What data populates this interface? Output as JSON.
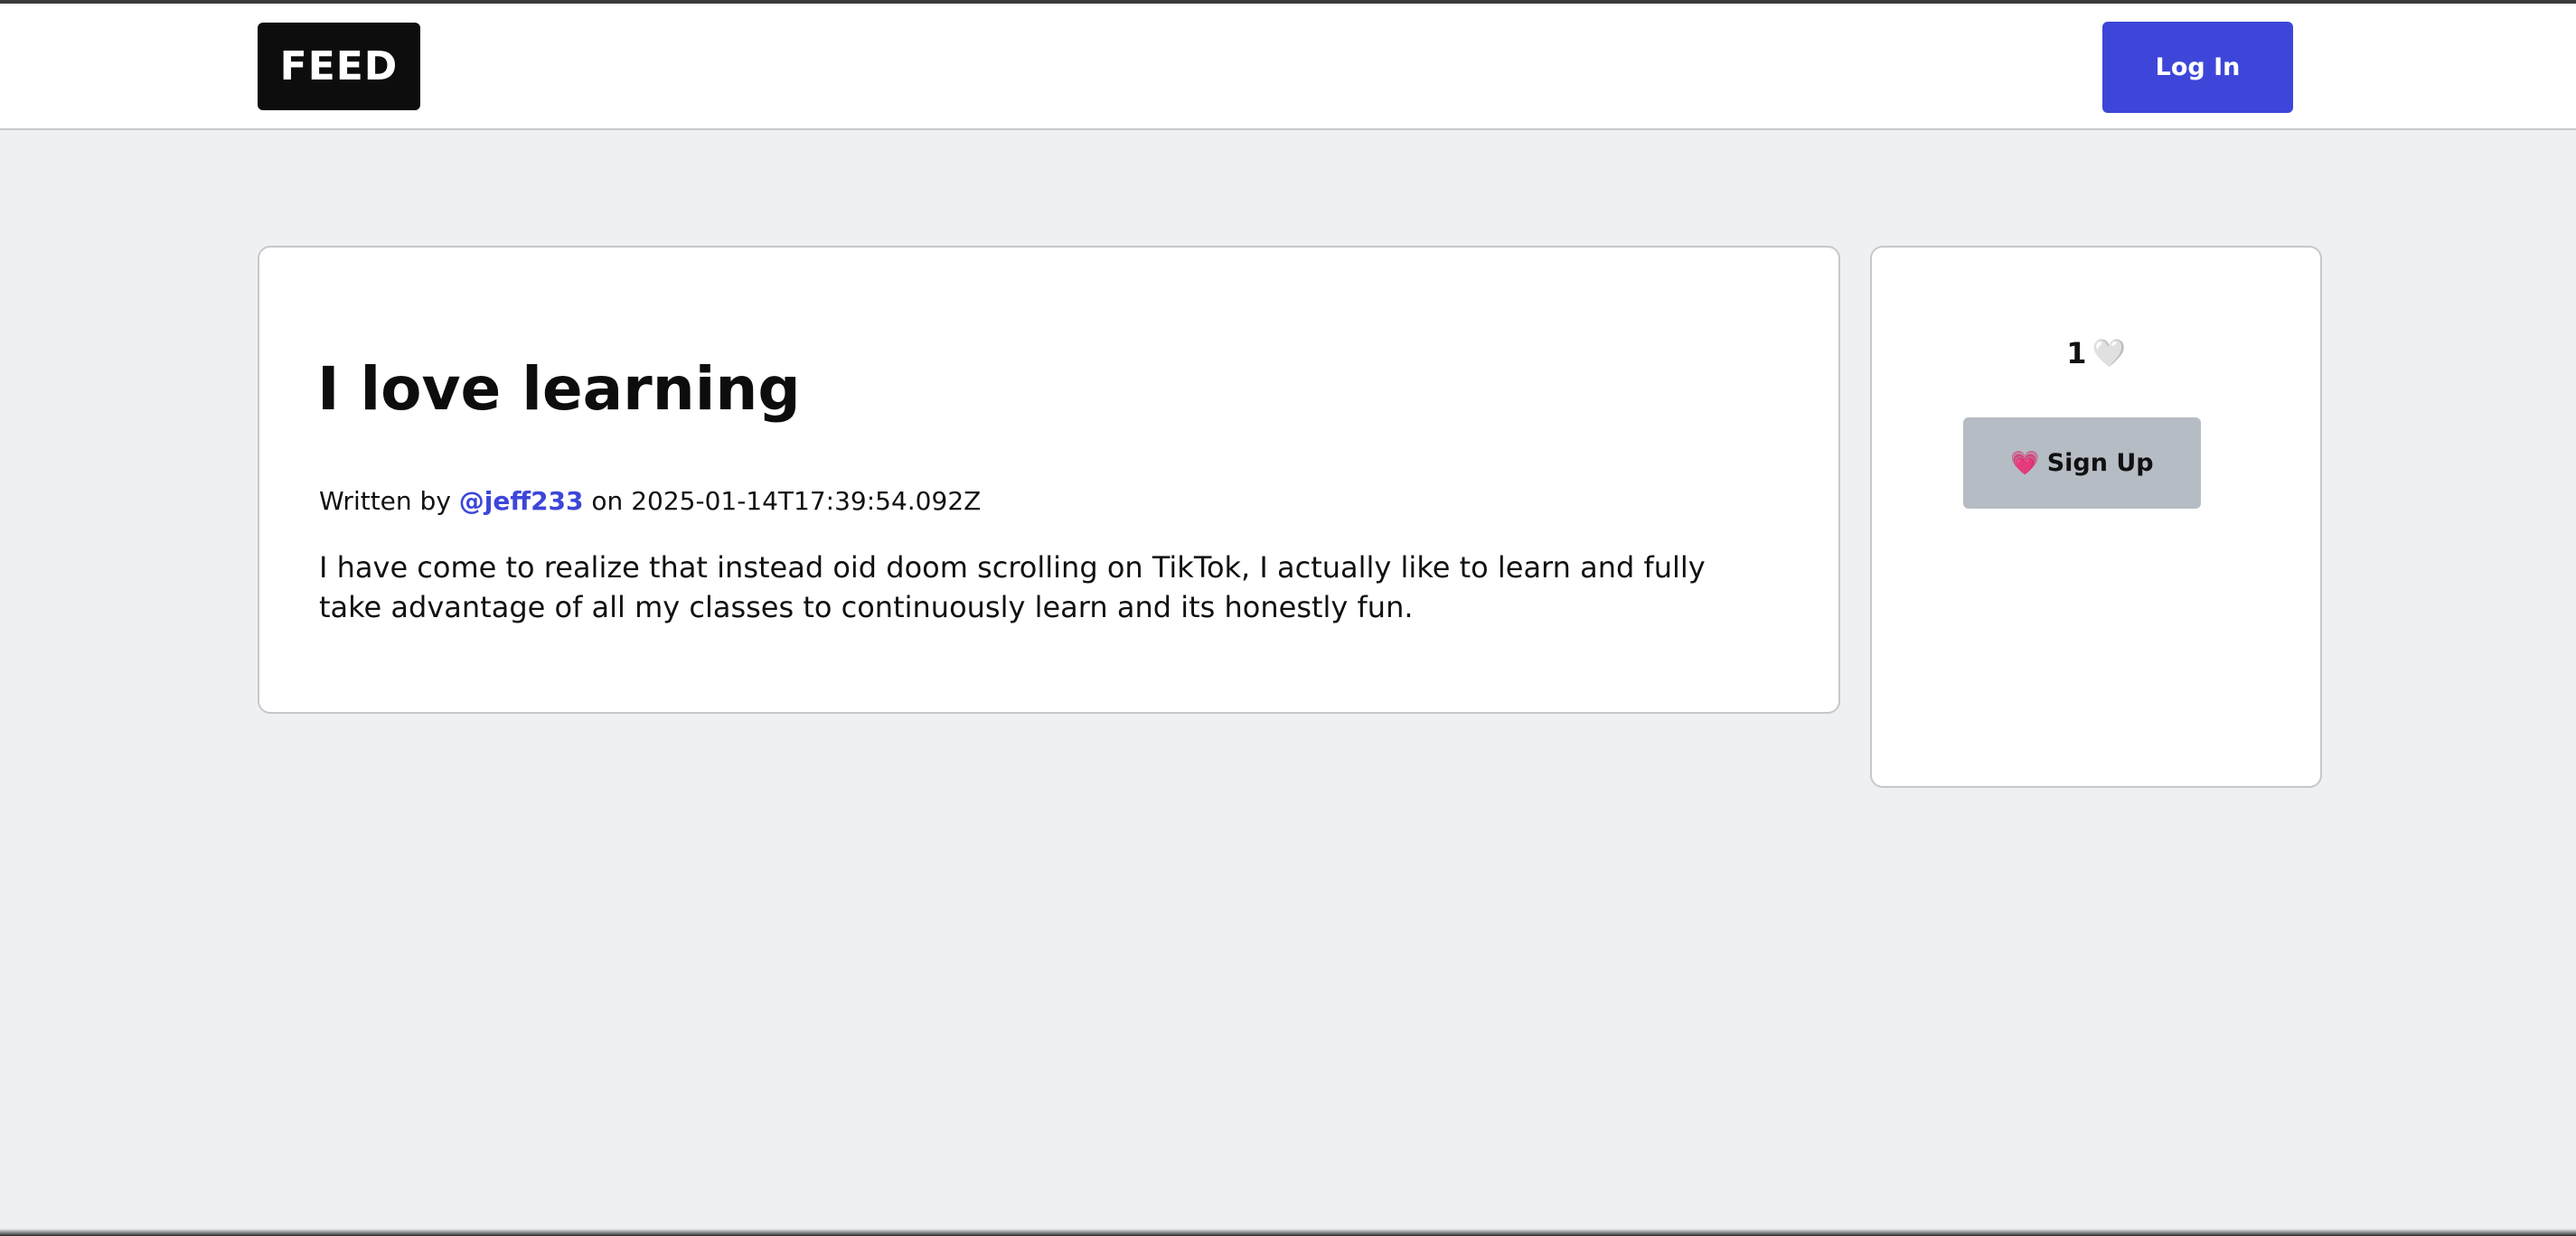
{
  "navbar": {
    "logo_text": "FEED",
    "login_label": "Log In"
  },
  "post": {
    "title": "I love learning",
    "written_by_prefix": "Written by ",
    "author": "@jeff233",
    "date_prefix": " on ",
    "date": "2025-01-14T17:39:54.092Z",
    "body": "I have come to realize that instead oid doom scrolling on TikTok, I actually like to learn and fully take advantage of all my classes to continuously learn and its honestly fun."
  },
  "sidebar": {
    "like_count": "1",
    "like_icon": "white-heart-icon",
    "like_glyph": "🤍",
    "signup_label": "Sign Up",
    "signup_icon": "sparkling-heart-icon",
    "signup_glyph": "💗"
  },
  "colors": {
    "accent": "#3d46d9",
    "page_background": "#eff0f2",
    "signup_button": "#b6bcc4",
    "logo_background": "#0d0d0d"
  }
}
